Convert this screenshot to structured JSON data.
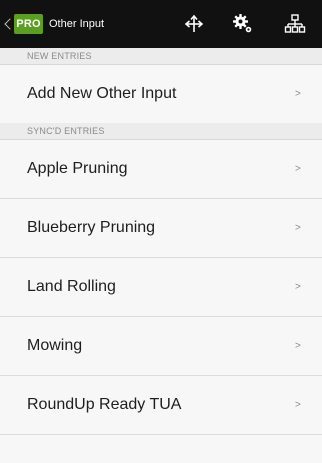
{
  "action_bar": {
    "logo": "PRO",
    "title": "Other Input",
    "actions": [
      {
        "name": "move-icon"
      },
      {
        "name": "gear-icon"
      },
      {
        "name": "hierarchy-icon"
      }
    ]
  },
  "sections": {
    "new_entries": {
      "header": "NEW ENTRIES",
      "items": [
        {
          "label": "Add New Other Input",
          "chevron": ">"
        }
      ]
    },
    "synced_entries": {
      "header": "SYNC'D ENTRIES",
      "items": [
        {
          "label": "Apple Pruning",
          "chevron": ">"
        },
        {
          "label": "Blueberry Pruning",
          "chevron": ">"
        },
        {
          "label": "Land Rolling",
          "chevron": ">"
        },
        {
          "label": "Mowing",
          "chevron": ">"
        },
        {
          "label": "RoundUp Ready TUA",
          "chevron": ">"
        }
      ]
    }
  },
  "colors": {
    "action_bar_bg": "#111111",
    "logo_green": "#5a9e22",
    "list_bg": "#f7f7f7",
    "section_bg": "#ececec"
  }
}
